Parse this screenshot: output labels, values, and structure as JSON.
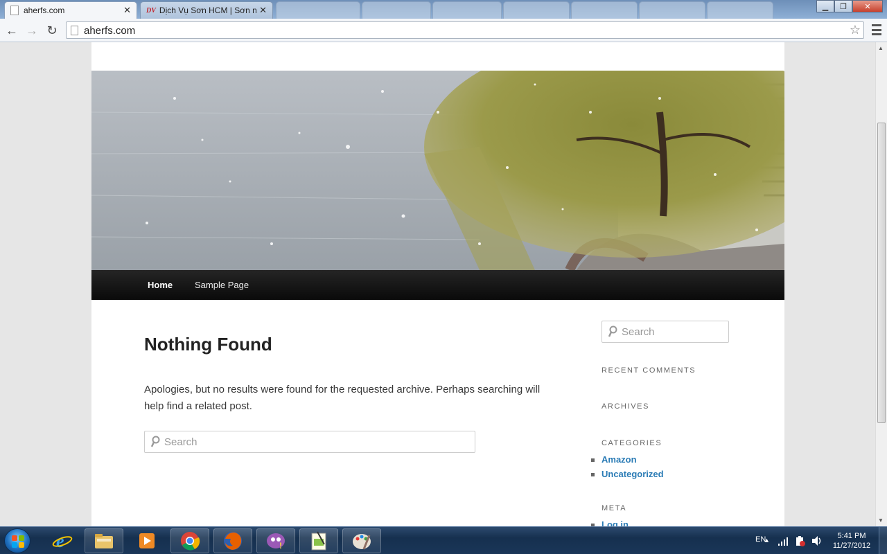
{
  "browser": {
    "tabs": [
      {
        "title": "aherfs.com",
        "active": true
      },
      {
        "title": "Dịch Vụ Sơn HCM | Sơn nhà",
        "active": false
      }
    ],
    "url": "aherfs.com",
    "colors": {
      "tabstrip": "#7a9cc5",
      "toolbar": "#f4f6f9"
    }
  },
  "site": {
    "nav": [
      {
        "label": "Home",
        "current": true
      },
      {
        "label": "Sample Page",
        "current": false
      }
    ],
    "main": {
      "title": "Nothing Found",
      "text": "Apologies, but no results were found for the requested archive. Perhaps searching will help find a related post.",
      "search_placeholder": "Search"
    },
    "sidebar": {
      "search_placeholder": "Search",
      "widgets": {
        "recent_comments": "RECENT COMMENTS",
        "archives": "ARCHIVES",
        "categories": "CATEGORIES",
        "meta": "META"
      },
      "categories": [
        "Amazon",
        "Uncategorized"
      ],
      "meta_links": [
        "Log in"
      ]
    },
    "colors": {
      "link": "#2a7bb5",
      "navbar": "#111111"
    }
  },
  "taskbar": {
    "language": "EN",
    "time": "5:41 PM",
    "date": "11/27/2012",
    "pinned_icons": [
      "windows-explorer-icon",
      "media-player-icon",
      "chrome-icon",
      "firefox-icon",
      "yahoo-messenger-icon",
      "notepad-icon",
      "paint-icon"
    ]
  }
}
